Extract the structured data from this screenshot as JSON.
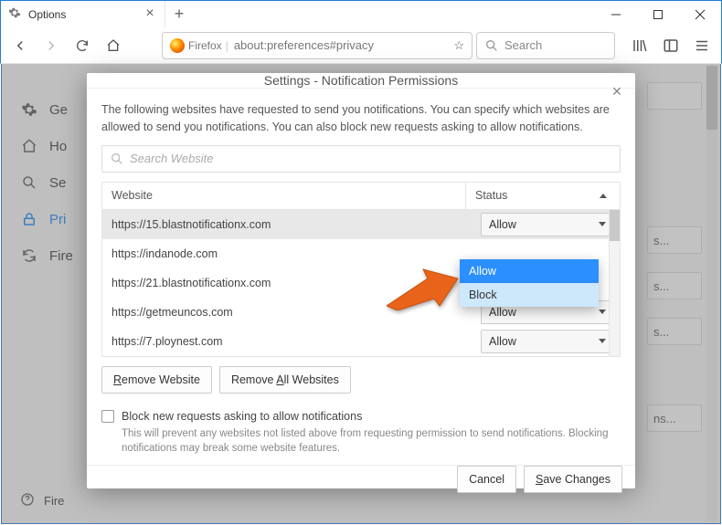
{
  "window": {
    "tab_title": "Options",
    "url_label": "Firefox",
    "url_value": "about:preferences#privacy",
    "search_placeholder": "Search"
  },
  "sidebar": {
    "items": [
      {
        "label": "Ge"
      },
      {
        "label": "Ho"
      },
      {
        "label": "Se"
      },
      {
        "label": "Pri"
      },
      {
        "label": "Fire"
      }
    ],
    "help_label": "Fire"
  },
  "ghost": {
    "box1": "",
    "boxn": "s...",
    "boxn2": "s...",
    "boxn3": "s...",
    "boxn4": "ns..."
  },
  "dialog": {
    "title": "Settings - Notification Permissions",
    "intro": "The following websites have requested to send you notifications. You can specify which websites are allowed to send you notifications. You can also block new requests asking to allow notifications.",
    "search_placeholder": "Search Website",
    "col_website": "Website",
    "col_status": "Status",
    "rows": [
      {
        "url": "https://15.blastnotificationx.com",
        "status": "Allow"
      },
      {
        "url": "https://indanode.com",
        "status": "Allow"
      },
      {
        "url": "https://21.blastnotificationx.com",
        "status": "Allow"
      },
      {
        "url": "https://getmeuncos.com",
        "status": "Allow"
      },
      {
        "url": "https://7.ploynest.com",
        "status": "Allow"
      }
    ],
    "dropdown": {
      "opt1": "Allow",
      "opt2": "Block"
    },
    "remove_website": "Remove Website",
    "remove_all": "Remove All Websites",
    "block_new_label": "Block new requests asking to allow notifications",
    "block_new_hint": "This will prevent any websites not listed above from requesting permission to send notifications. Blocking notifications may break some website features.",
    "cancel": "Cancel",
    "save": "Save Changes"
  }
}
